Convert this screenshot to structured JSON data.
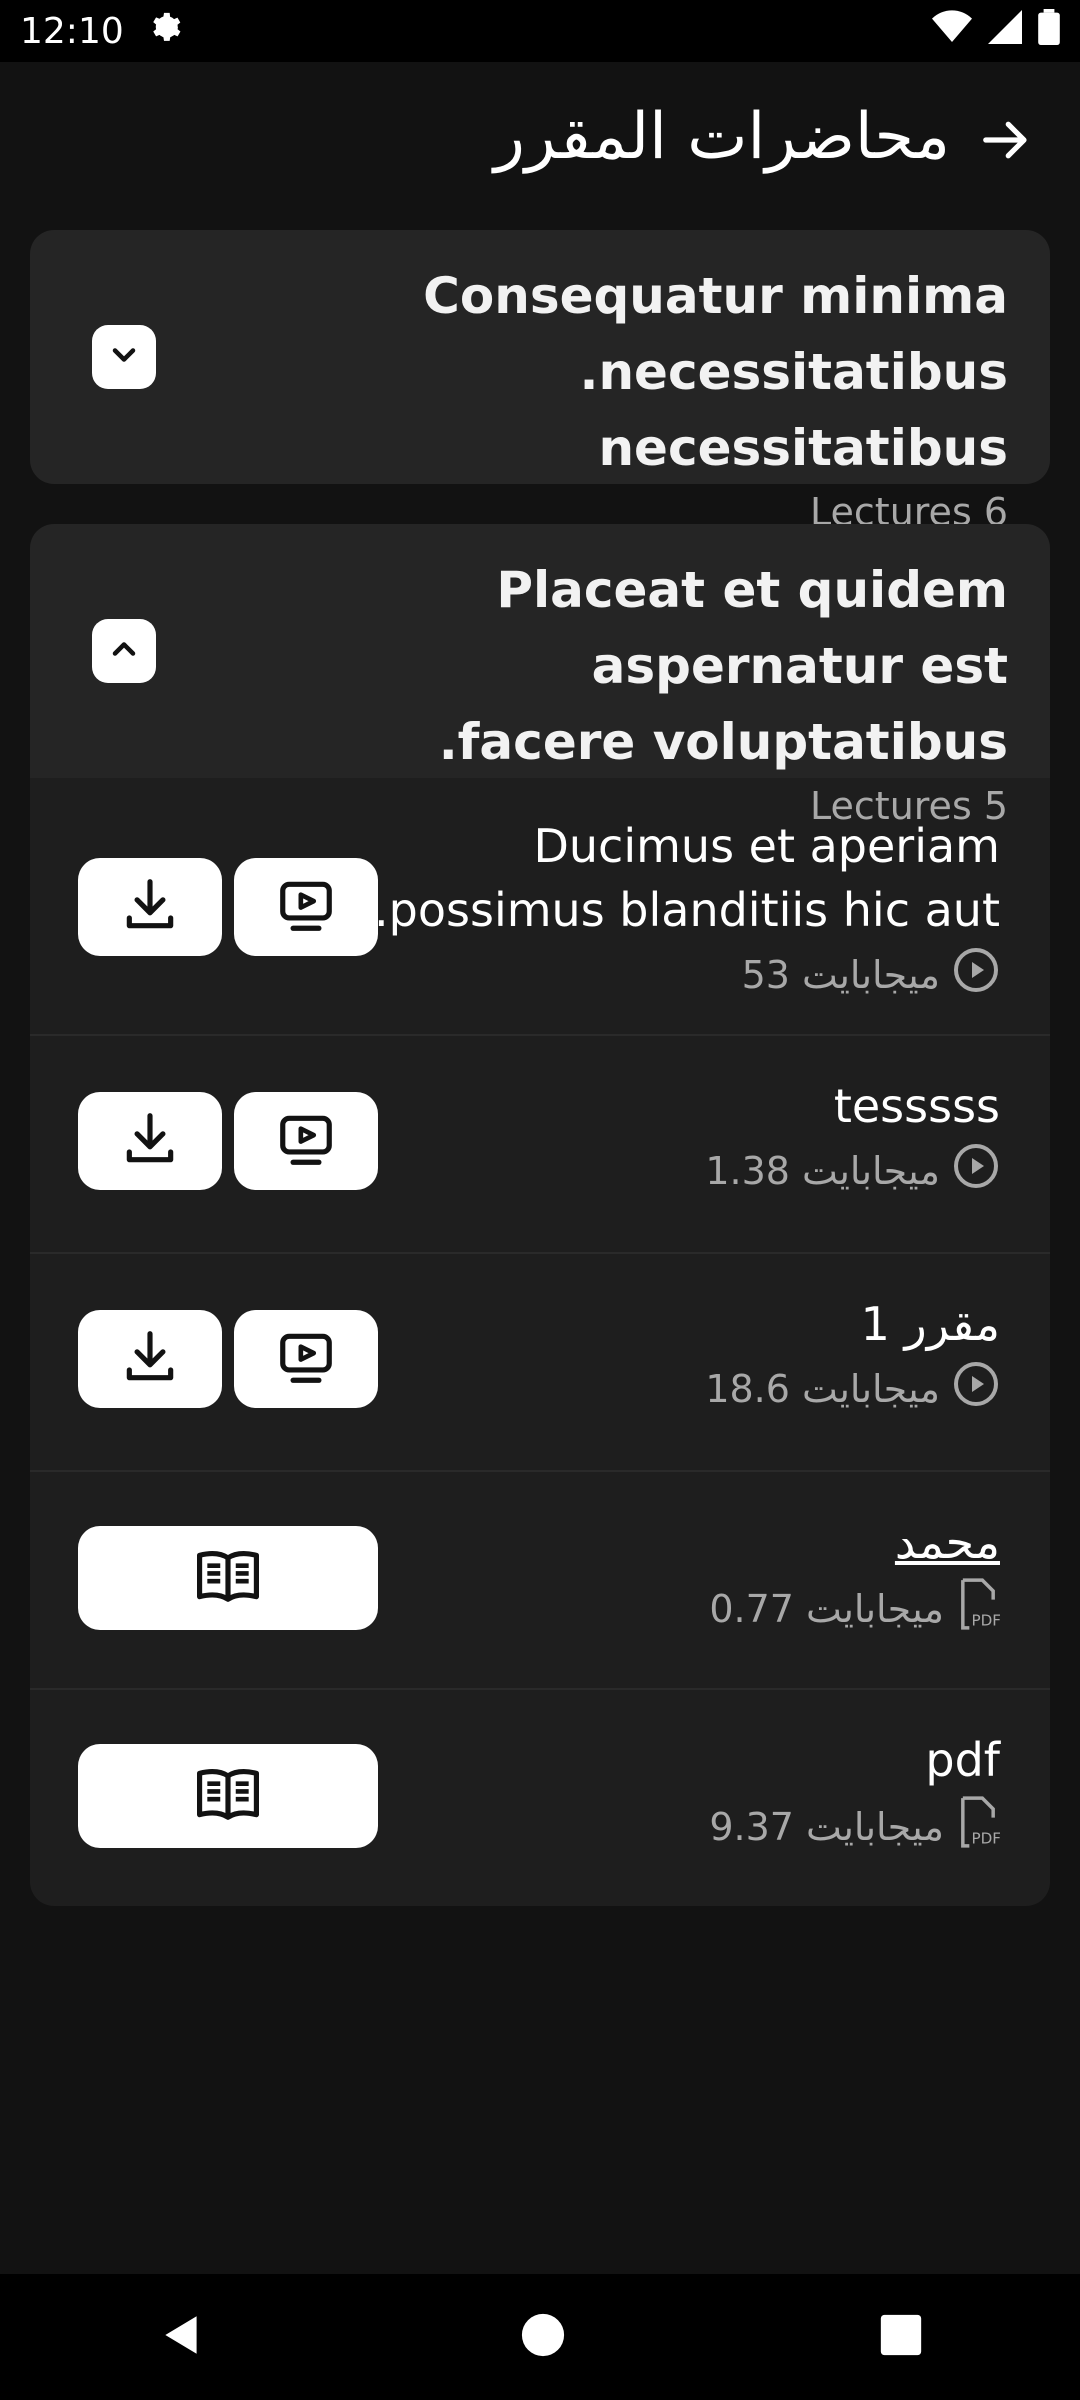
{
  "status": {
    "time": "12:10"
  },
  "header": {
    "title": "محاضرات المقرر"
  },
  "sections": [
    {
      "title_line1": "Consequatur minima",
      "title_line2": ".necessitatibus necessitatibus",
      "count": "Lectures 6"
    },
    {
      "title_line1": "Placeat et quidem aspernatur est",
      "title_line2": ".facere voluptatibus",
      "count": "Lectures 5",
      "items": [
        {
          "title_line1": "Ducimus et aperiam",
          "title_line2": ".possimus blanditiis hic aut",
          "size": "53 ميجابايت",
          "type": "video"
        },
        {
          "title_line1": "tesssss",
          "size": "1.38 ميجابايت",
          "type": "video"
        },
        {
          "title_line1": "مقرر 1",
          "size": "18.6 ميجابايت",
          "type": "video"
        },
        {
          "title_line1": "محمد",
          "size": "0.77 ميجابايت",
          "type": "pdf"
        },
        {
          "title_line1": "pdf",
          "size": "9.37 ميجابايت",
          "type": "pdf"
        }
      ]
    }
  ],
  "icons": {
    "back": "arrow-right-icon",
    "expand": "chevron-down-icon",
    "collapse": "chevron-up-icon",
    "play": "play-circle-icon",
    "pdf": "pdf-file-icon",
    "watch": "video-player-icon",
    "download": "download-icon",
    "read": "open-book-icon"
  },
  "colors": {
    "background": "#121212",
    "card": "#252525",
    "item": "#1e1e1e",
    "button": "#ffffff"
  }
}
